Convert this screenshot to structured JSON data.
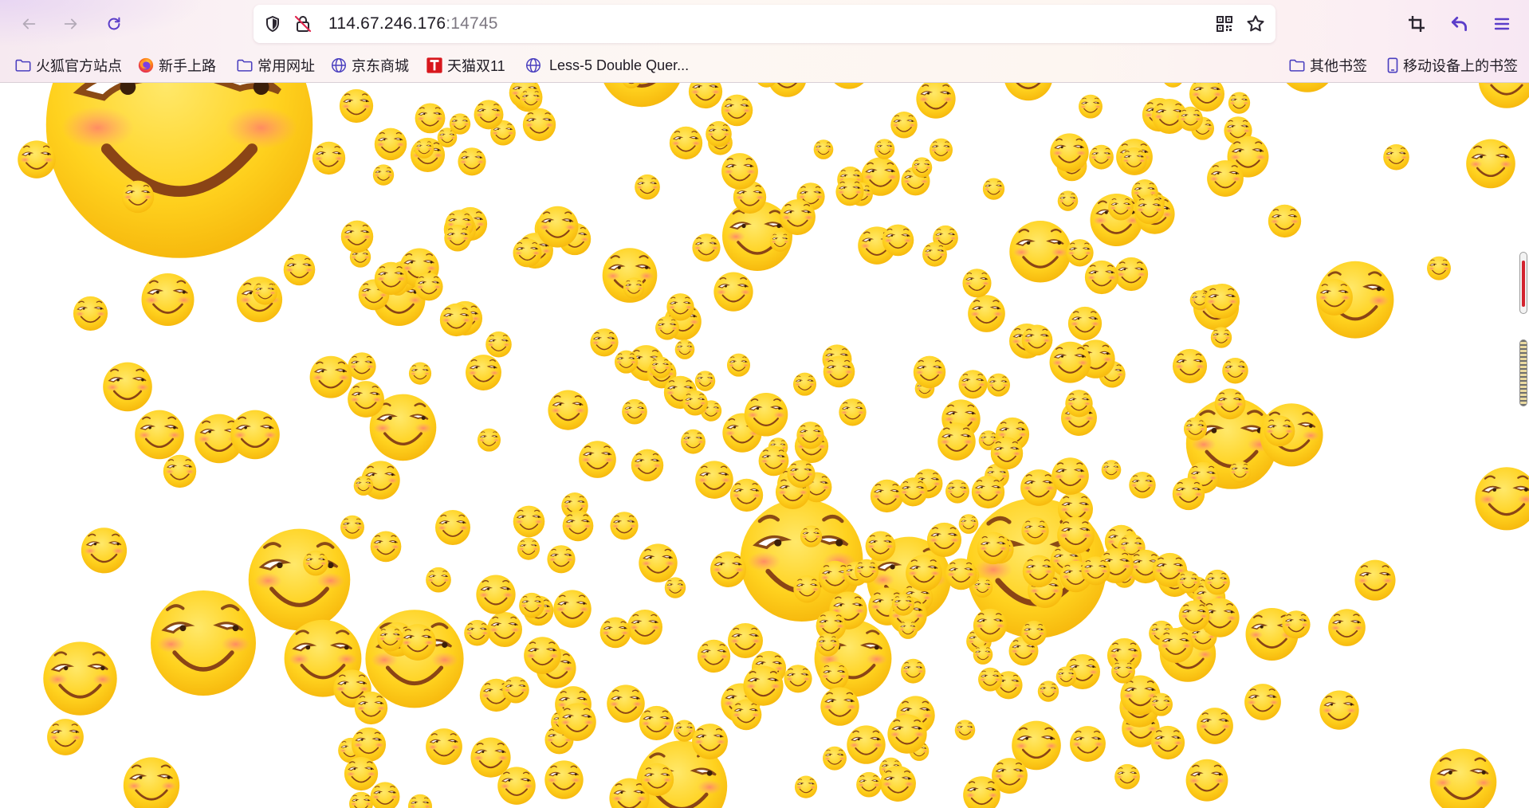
{
  "browser": {
    "url_host": "114.67.246.176",
    "url_port": ":14745",
    "accent_color": "#5b3dc9"
  },
  "bookmarks": {
    "left": [
      {
        "label": "火狐官方站点",
        "icon": "folder-icon"
      },
      {
        "label": "新手上路",
        "icon": "firefox-icon"
      },
      {
        "label": "常用网址",
        "icon": "folder-icon"
      },
      {
        "label": "京东商城",
        "icon": "globe-icon"
      },
      {
        "label": "天猫双11",
        "icon": "tmall-icon"
      },
      {
        "label": "Less-5 Double Quer...",
        "icon": "globe-icon"
      }
    ],
    "right": [
      {
        "label": "其他书签",
        "icon": "folder-icon"
      },
      {
        "label": "移动设备上的书签",
        "icon": "mobile-icon"
      }
    ]
  },
  "page": {
    "content": "smiley-emoji-field",
    "emoji_color": "#ffd21f",
    "cheek_color": "#ff8a73"
  }
}
